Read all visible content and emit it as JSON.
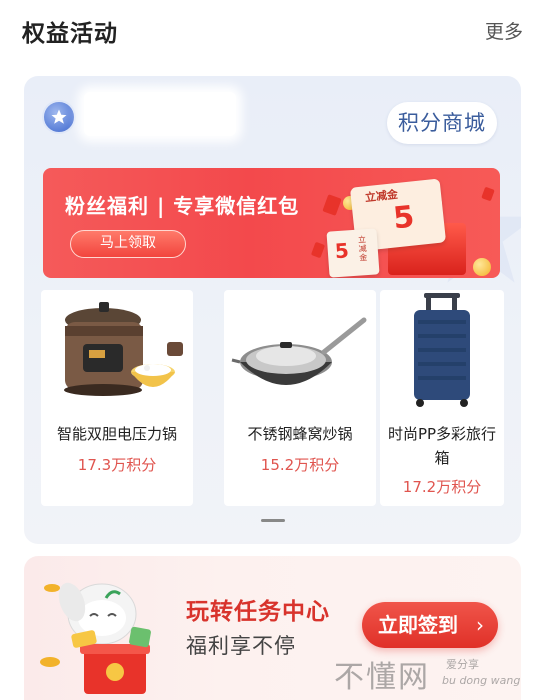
{
  "header": {
    "title": "权益活动",
    "more_label": "更多"
  },
  "card": {
    "badge_icon": "star-badge-icon",
    "mall_button_label": "积分商城",
    "banner": {
      "title": "粉丝福利 | 专享微信红包",
      "button_label": "马上领取",
      "envelope_big_label": "立减金",
      "envelope_big_value": "5",
      "envelope_small_value": "5",
      "envelope_small_label": "立减金"
    },
    "products": [
      {
        "name": "智能双胆电压力锅",
        "points": "17.3万积分",
        "icon": "pressure-cooker-icon"
      },
      {
        "name": "不锈钢蜂窝炒锅",
        "points": "15.2万积分",
        "icon": "wok-icon"
      },
      {
        "name": "时尚PP多彩旅行箱",
        "points": "17.2万积分",
        "icon": "suitcase-icon"
      }
    ]
  },
  "task": {
    "title": "玩转任务中心",
    "subtitle": "福利享不停",
    "button_label": "立即签到",
    "button_chevron": "›"
  },
  "watermark": {
    "big": "不懂网",
    "small1": "爱分享",
    "small2": "bu dong wang"
  },
  "colors": {
    "accent_red": "#e8332a",
    "price_red": "#e0554f",
    "mall_blue": "#3a5c9c"
  }
}
